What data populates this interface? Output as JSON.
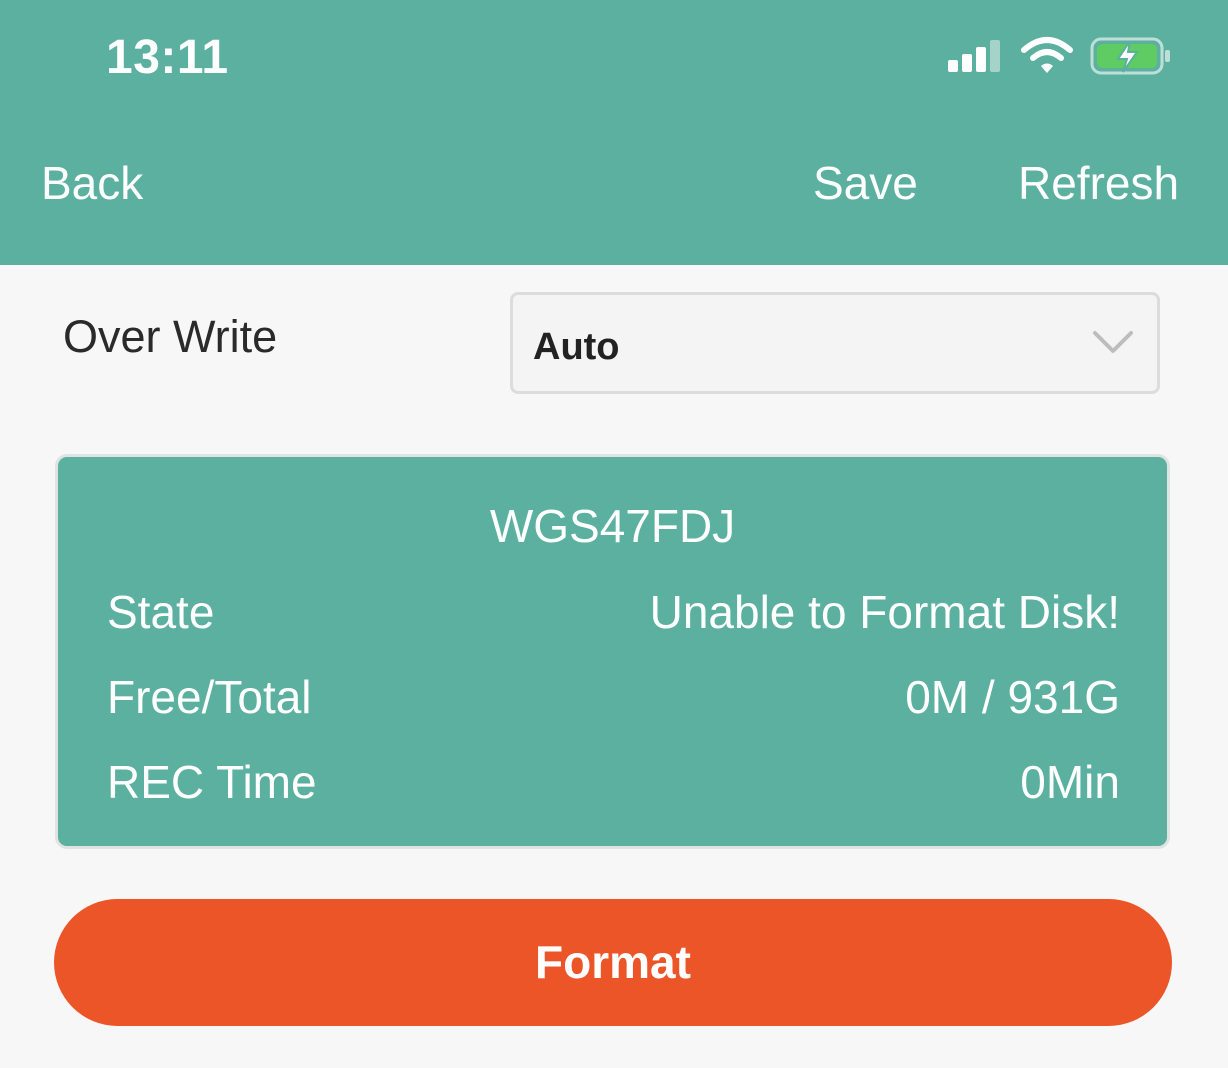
{
  "status_bar": {
    "time": "13:11",
    "signal_icon": "cellular-signal-icon",
    "wifi_icon": "wifi-icon",
    "battery_icon": "battery-charging-icon"
  },
  "nav": {
    "back_label": "Back",
    "save_label": "Save",
    "refresh_label": "Refresh"
  },
  "overwrite": {
    "label": "Over Write",
    "selected": "Auto",
    "chevron_icon": "chevron-down-icon"
  },
  "disk": {
    "name": "WGS47FDJ",
    "rows": [
      {
        "label": "State",
        "value": "Unable to Format Disk!"
      },
      {
        "label": "Free/Total",
        "value": "0M / 931G"
      },
      {
        "label": "REC Time",
        "value": "0Min"
      }
    ]
  },
  "format_button": {
    "label": "Format"
  },
  "colors": {
    "header": "#5bb09f",
    "card": "#5bb09f",
    "format_button": "#ec5527",
    "page_background": "#f7f7f7",
    "battery_fill": "#5ecb63"
  }
}
